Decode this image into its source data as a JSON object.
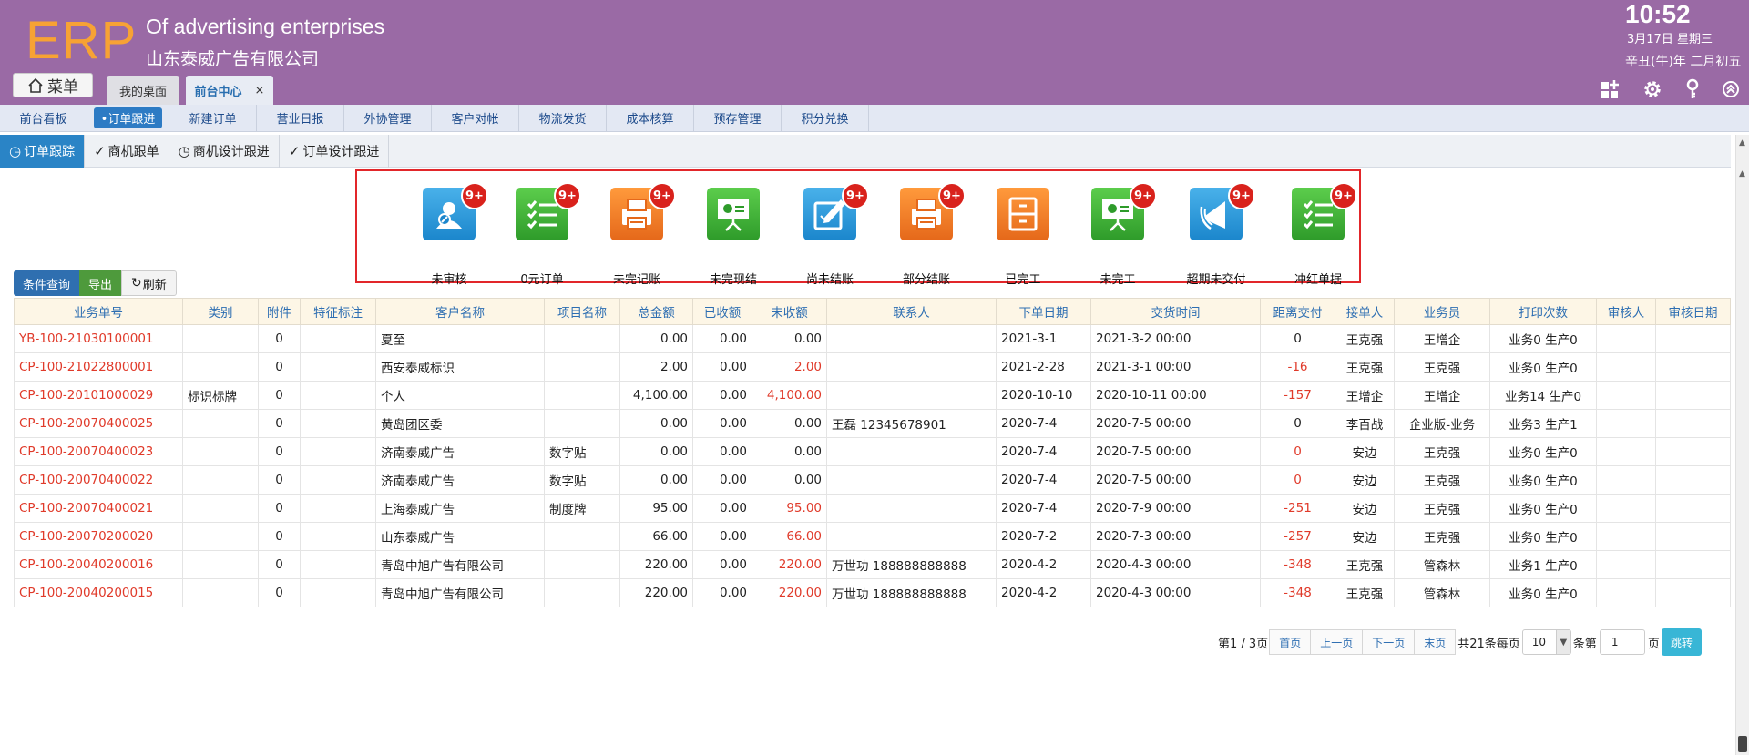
{
  "header": {
    "logo": "ERP",
    "company_en": "Of advertising enterprises",
    "company_cn": "山东泰威广告有限公司",
    "time": "10:52",
    "date": "3月17日 星期三",
    "lunar": "辛丑(牛)年 二月初五",
    "menu_label": "菜单",
    "tabs": [
      {
        "label": "我的桌面"
      },
      {
        "label": "前台中心",
        "close": "×"
      }
    ],
    "icons": [
      "grid-add-icon",
      "gear-icon",
      "key-icon",
      "collapse-icon"
    ]
  },
  "module_nav": [
    "前台看板",
    "•订单跟进",
    "新建订单",
    "营业日报",
    "外协管理",
    "客户对帐",
    "物流发货",
    "成本核算",
    "预存管理",
    "积分兑换"
  ],
  "sub_tabs": [
    "订单跟踪",
    "商机跟单",
    "商机设计跟进",
    "订单设计跟进"
  ],
  "tiles": [
    {
      "label": "未审核",
      "badge": "9+",
      "color": "blue",
      "icon": "user-edit-icon"
    },
    {
      "label": "0元订单",
      "badge": "9+",
      "color": "green",
      "icon": "checklist-icon"
    },
    {
      "label": "未完记账",
      "badge": "9+",
      "color": "orange",
      "icon": "printer-icon"
    },
    {
      "label": "未完现结",
      "badge": "",
      "color": "green",
      "icon": "presentation-icon"
    },
    {
      "label": "尚未结账",
      "badge": "9+",
      "color": "blue",
      "icon": "pencil-board-icon"
    },
    {
      "label": "部分结账",
      "badge": "9+",
      "color": "orange",
      "icon": "printer-icon"
    },
    {
      "label": "已完工",
      "badge": "",
      "color": "orange",
      "icon": "cabinet-icon"
    },
    {
      "label": "未完工",
      "badge": "9+",
      "color": "green",
      "icon": "presentation-icon"
    },
    {
      "label": "超期未交付",
      "badge": "9+",
      "color": "blue",
      "icon": "megaphone-icon"
    },
    {
      "label": "冲红单据",
      "badge": "9+",
      "color": "green",
      "icon": "checklist-icon"
    }
  ],
  "toolbar": {
    "query": "条件查询",
    "export": "导出",
    "refresh": "刷新"
  },
  "table": {
    "columns": [
      "业务单号",
      "类别",
      "附件",
      "特征标注",
      "客户名称",
      "项目名称",
      "总金额",
      "已收额",
      "未收额",
      "联系人",
      "下单日期",
      "交货时间",
      "距离交付",
      "接单人",
      "业务员",
      "打印次数",
      "审核人",
      "审核日期"
    ],
    "rows": [
      [
        "YB-100-21030100001",
        "",
        "0",
        "",
        "夏至",
        "",
        "0.00",
        "0.00",
        "0.00",
        "",
        "2021-3-1",
        "2021-3-2 00:00",
        "0",
        "王克强",
        "王增企",
        "业务0 生产0",
        "",
        ""
      ],
      [
        "CP-100-21022800001",
        "",
        "0",
        "",
        "西安泰威标识",
        "",
        "2.00",
        "0.00",
        "2.00",
        "",
        "2021-2-28",
        "2021-3-1 00:00",
        "-16",
        "王克强",
        "王克强",
        "业务0 生产0",
        "",
        ""
      ],
      [
        "CP-100-20101000029",
        "标识标牌",
        "0",
        "",
        "个人",
        "",
        "4,100.00",
        "0.00",
        "4,100.00",
        "",
        "2020-10-10",
        "2020-10-11 00:00",
        "-157",
        "王增企",
        "王增企",
        "业务14 生产0",
        "",
        ""
      ],
      [
        "CP-100-20070400025",
        "",
        "0",
        "",
        "黄岛团区委",
        "",
        "0.00",
        "0.00",
        "0.00",
        "王磊 12345678901",
        "2020-7-4",
        "2020-7-5 00:00",
        "0",
        "李百战",
        "企业版-业务",
        "业务3 生产1",
        "",
        ""
      ],
      [
        "CP-100-20070400023",
        "",
        "0",
        "",
        "济南泰威广告",
        "数字贴",
        "0.00",
        "0.00",
        "0.00",
        "",
        "2020-7-4",
        "2020-7-5 00:00",
        "0",
        "安边",
        "王克强",
        "业务0 生产0",
        "",
        ""
      ],
      [
        "CP-100-20070400022",
        "",
        "0",
        "",
        "济南泰威广告",
        "数字贴",
        "0.00",
        "0.00",
        "0.00",
        "",
        "2020-7-4",
        "2020-7-5 00:00",
        "0",
        "安边",
        "王克强",
        "业务0 生产0",
        "",
        ""
      ],
      [
        "CP-100-20070400021",
        "",
        "0",
        "",
        "上海泰威广告",
        "制度牌",
        "95.00",
        "0.00",
        "95.00",
        "",
        "2020-7-4",
        "2020-7-9 00:00",
        "-251",
        "安边",
        "王克强",
        "业务0 生产0",
        "",
        ""
      ],
      [
        "CP-100-20070200020",
        "",
        "0",
        "",
        "山东泰威广告",
        "",
        "66.00",
        "0.00",
        "66.00",
        "",
        "2020-7-2",
        "2020-7-3 00:00",
        "-257",
        "安边",
        "王克强",
        "业务0 生产0",
        "",
        ""
      ],
      [
        "CP-100-20040200016",
        "",
        "0",
        "",
        "青岛中旭广告有限公司",
        "",
        "220.00",
        "0.00",
        "220.00",
        "万世功 188888888888",
        "2020-4-2",
        "2020-4-3 00:00",
        "-348",
        "王克强",
        "管森林",
        "业务1 生产0",
        "",
        ""
      ],
      [
        "CP-100-20040200015",
        "",
        "0",
        "",
        "青岛中旭广告有限公司",
        "",
        "220.00",
        "0.00",
        "220.00",
        "万世功 188888888888",
        "2020-4-2",
        "2020-4-3 00:00",
        "-348",
        "王克强",
        "管森林",
        "业务0 生产0",
        "",
        ""
      ]
    ],
    "red_unpaid": [
      false,
      true,
      true,
      false,
      false,
      false,
      true,
      true,
      true,
      true
    ],
    "red_distance": [
      false,
      true,
      true,
      false,
      true,
      true,
      true,
      true,
      true,
      true
    ]
  },
  "pager": {
    "page_info": "第1 / 3页",
    "first": "首页",
    "prev": "上一页",
    "next": "下一页",
    "last": "末页",
    "total": "共21条每页",
    "page_size": "10",
    "per_page_suffix": "条第",
    "page_input": "1",
    "page_suffix": "页",
    "jump": "跳转"
  },
  "colors": {
    "header_bg": "#9a6aa5",
    "logo": "#f7a234",
    "accent_blue": "#2a84c6",
    "red": "#e03a2a"
  }
}
